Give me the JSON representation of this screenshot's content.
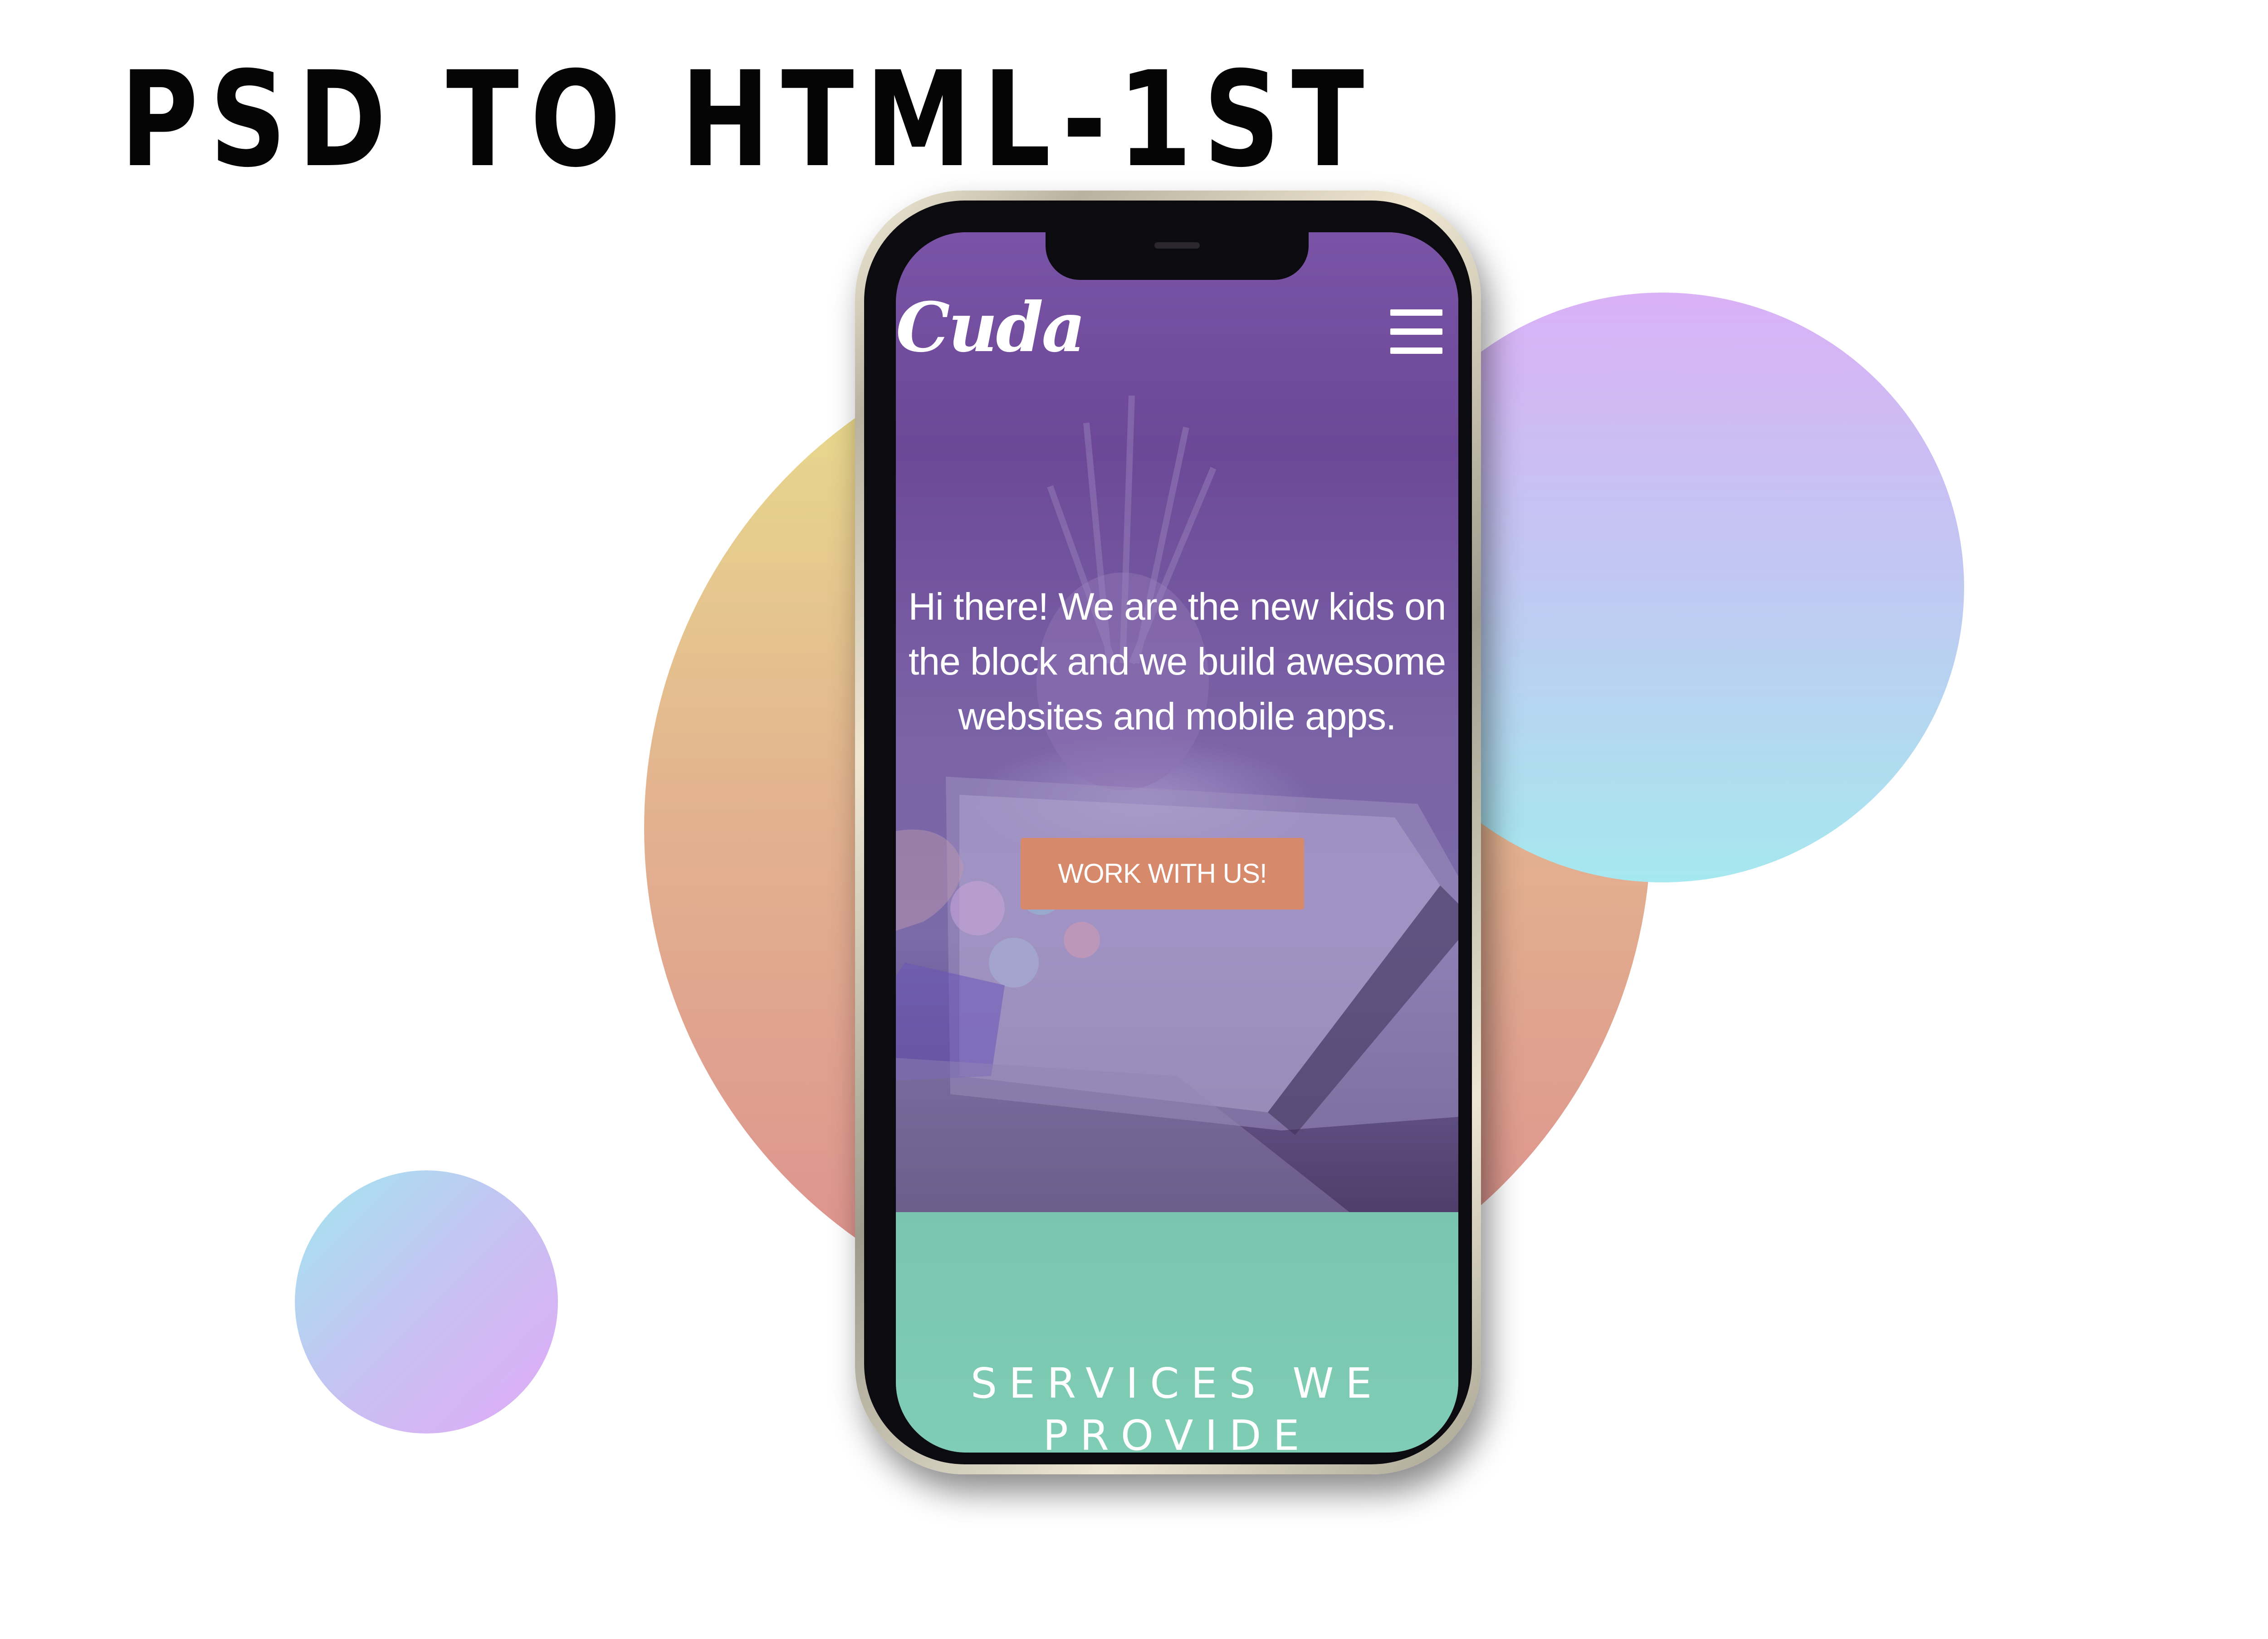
{
  "page": {
    "title": "PSD TO HTML-1ST"
  },
  "app": {
    "logo": "Cuda",
    "menu_icon": "hamburger-menu-icon",
    "hero": {
      "headline": "Hi there! We are the new kids on the block and we build awesome websites and mobile apps.",
      "cta_label": "WORK WITH US!"
    },
    "services": {
      "title": "SERVICES WE PROVIDE"
    }
  },
  "colors": {
    "hero_purple": "#6c4897",
    "cta_orange": "#d7896b",
    "services_mint": "#7ac5ad",
    "headline_black": "#050505"
  }
}
